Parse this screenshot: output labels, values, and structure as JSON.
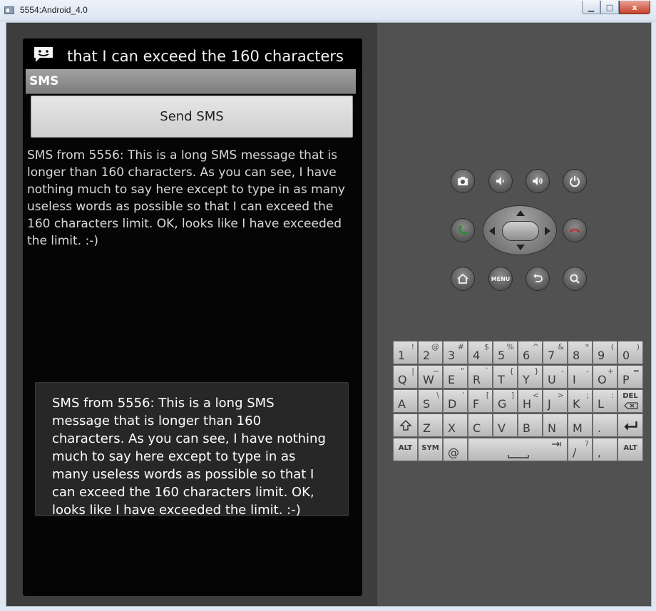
{
  "window": {
    "title": "5554:Android_4.0",
    "minimize_glyph": "▁",
    "maximize_glyph": "□",
    "close_glyph": "x"
  },
  "device": {
    "notification_text": "that I can exceed the 160 characters",
    "app_title": "SMS",
    "send_button_label": "Send SMS",
    "received_message": "SMS from 5556: This is a long SMS message that is longer than 160 characters. As you can see, I have nothing much to say here except to type in as many useless words as possible so that I can exceed the 160 characters limit. OK, looks like I have exceeded the limit. :-)",
    "toast_message": "SMS from 5556: This is a long SMS message that is longer than 160 characters. As you can see, I have nothing much to say here except to type in as many useless words as possible so that I can exceed the 160 characters limit. OK, looks like I have exceeded the limit. :-)"
  },
  "controls": {
    "menu_label": "MENU",
    "call_color": "#2e8b3a",
    "end_call_color": "#c8282a"
  },
  "keyboard": {
    "row1": [
      {
        "main": "1",
        "alt": "!"
      },
      {
        "main": "2",
        "alt": "@"
      },
      {
        "main": "3",
        "alt": "#"
      },
      {
        "main": "4",
        "alt": "$"
      },
      {
        "main": "5",
        "alt": "%"
      },
      {
        "main": "6",
        "alt": "^"
      },
      {
        "main": "7",
        "alt": "&"
      },
      {
        "main": "8",
        "alt": "*"
      },
      {
        "main": "9",
        "alt": "("
      },
      {
        "main": "0",
        "alt": ")"
      }
    ],
    "row2": [
      {
        "main": "Q",
        "alt": "|"
      },
      {
        "main": "W",
        "alt": "~"
      },
      {
        "main": "E",
        "alt": "\""
      },
      {
        "main": "R",
        "alt": "`"
      },
      {
        "main": "T",
        "alt": "{"
      },
      {
        "main": "Y",
        "alt": "}"
      },
      {
        "main": "U",
        "alt": "-"
      },
      {
        "main": "I",
        "alt": "-"
      },
      {
        "main": "O",
        "alt": "+"
      },
      {
        "main": "P",
        "alt": "="
      }
    ],
    "row3": [
      {
        "main": "A",
        "alt": ""
      },
      {
        "main": "S",
        "alt": "\\"
      },
      {
        "main": "D",
        "alt": "'"
      },
      {
        "main": "F",
        "alt": "["
      },
      {
        "main": "G",
        "alt": "]"
      },
      {
        "main": "H",
        "alt": "<"
      },
      {
        "main": "J",
        "alt": ">"
      },
      {
        "main": "K",
        "alt": ";"
      },
      {
        "main": "L",
        "alt": ":"
      }
    ],
    "del_label": "DEL",
    "row4": [
      {
        "main": "Z",
        "alt": ""
      },
      {
        "main": "X",
        "alt": ""
      },
      {
        "main": "C",
        "alt": ""
      },
      {
        "main": "V",
        "alt": ""
      },
      {
        "main": "B",
        "alt": ""
      },
      {
        "main": "N",
        "alt": ""
      },
      {
        "main": "M",
        "alt": ""
      },
      {
        "main": ".",
        "alt": ""
      }
    ],
    "alt_label": "ALT",
    "sym_label": "SYM",
    "at_label": "@",
    "slash_main": "/",
    "slash_alt": "?",
    "comma_main": ",",
    "alt_right_label": "ALT"
  }
}
